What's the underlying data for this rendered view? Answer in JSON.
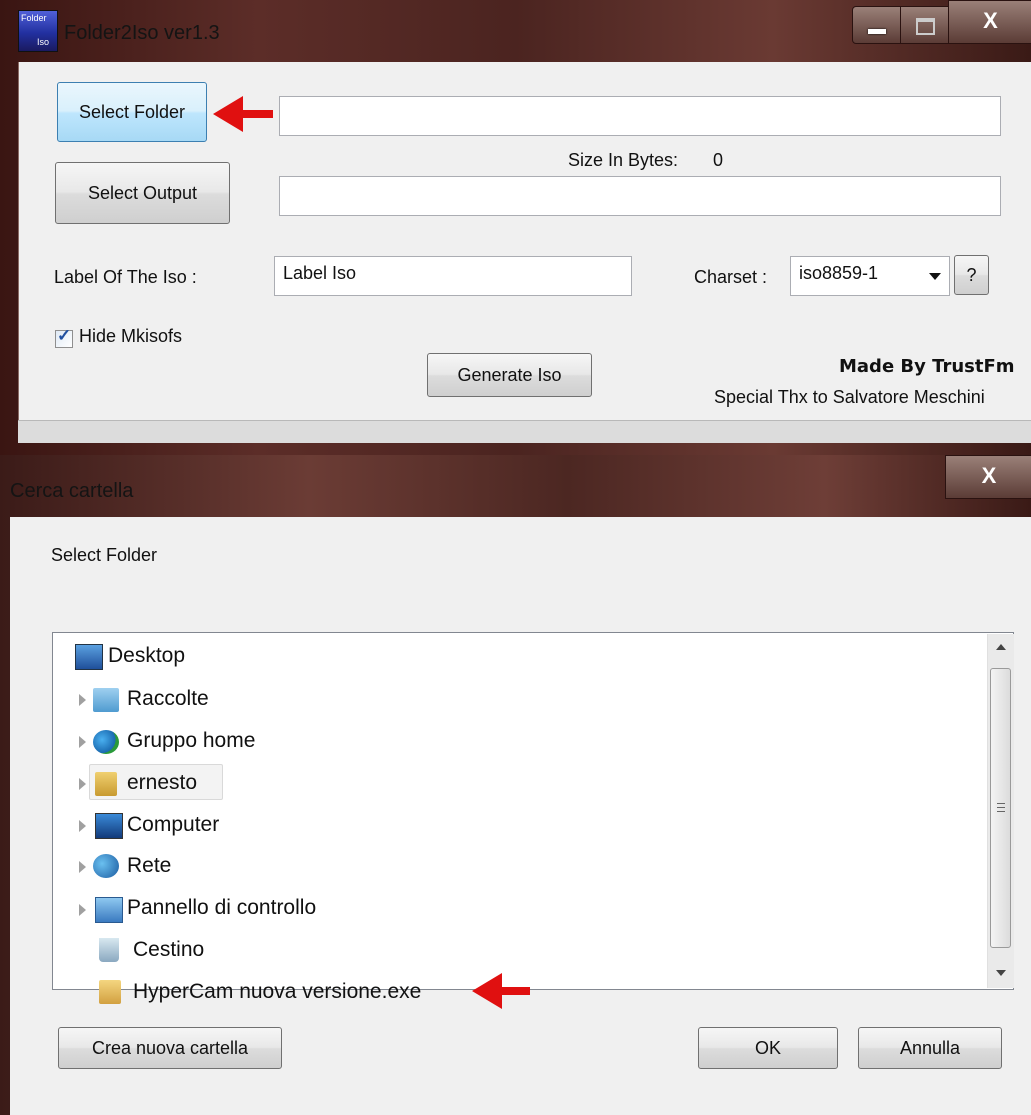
{
  "main_window": {
    "title": "Folder2Iso ver1.3",
    "icon": "folder2iso-app-icon",
    "icon_text_top": "Folder",
    "icon_text_bottom": "Iso",
    "caption_close": "X",
    "select_folder_label": "Select Folder",
    "select_output_label": "Select Output",
    "folder_path_value": "",
    "output_path_value": "",
    "size_label": "Size In Bytes:",
    "size_value": "0",
    "iso_label_caption": "Label Of The Iso :",
    "iso_label_value": "Label Iso",
    "charset_caption": "Charset :",
    "charset_value": "iso8859-1",
    "help_button_label": "?",
    "hide_mkisofs_label": "Hide Mkisofs",
    "hide_mkisofs_checked": true,
    "generate_button_label": "Generate Iso",
    "credit_made_by": "Made By TrustFm",
    "credit_thanks": "Special Thx to Salvatore Meschini"
  },
  "dialog": {
    "title": "Cerca cartella",
    "close_label": "X",
    "prompt": "Select Folder",
    "tree_items": [
      {
        "label": "Desktop",
        "icon": "desktop-icon",
        "expandable": false
      },
      {
        "label": "Raccolte",
        "icon": "libraries-icon",
        "expandable": true
      },
      {
        "label": "Gruppo home",
        "icon": "homegroup-icon",
        "expandable": true
      },
      {
        "label": "ernesto",
        "icon": "user-folder-icon",
        "expandable": true,
        "selected": true
      },
      {
        "label": "Computer",
        "icon": "computer-icon",
        "expandable": true
      },
      {
        "label": "Rete",
        "icon": "network-icon",
        "expandable": true
      },
      {
        "label": "Pannello di controllo",
        "icon": "control-panel-icon",
        "expandable": true
      },
      {
        "label": "Cestino",
        "icon": "recycle-bin-icon",
        "expandable": false
      },
      {
        "label": "HyperCam nuova versione.exe",
        "icon": "folder-icon",
        "expandable": false
      }
    ],
    "new_folder_button": "Crea nuova cartella",
    "ok_button": "OK",
    "cancel_button": "Annulla"
  },
  "colors": {
    "annotation_arrow": "#e01010",
    "window_frame": "#5c2d28",
    "client_bg": "#f0f0f0"
  }
}
